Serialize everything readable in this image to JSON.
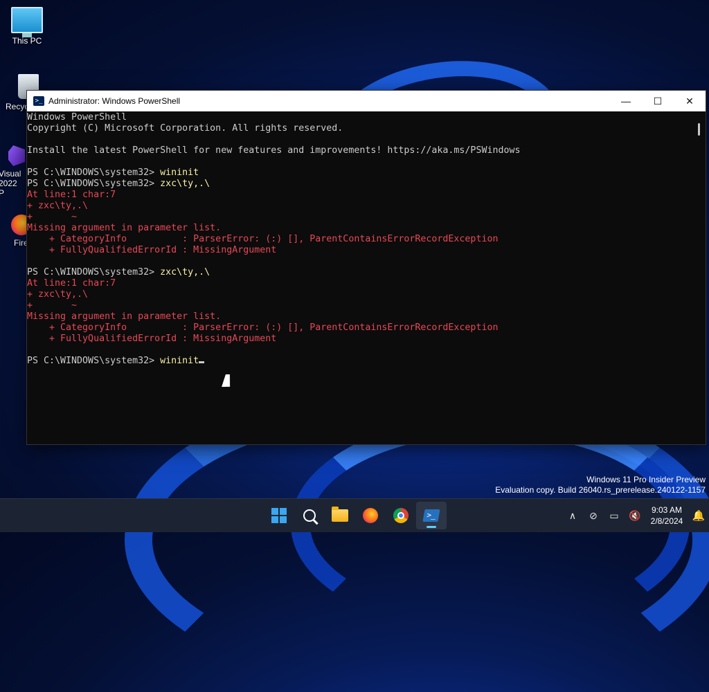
{
  "desktop": {
    "icons": [
      {
        "label": "This PC"
      },
      {
        "label": "Recyc"
      },
      {
        "label": "Visual 2022 P"
      },
      {
        "label": "Fire"
      }
    ]
  },
  "window": {
    "title": "Administrator: Windows PowerShell",
    "controls": {
      "minimize": "—",
      "maximize": "☐",
      "close": "✕"
    }
  },
  "console": {
    "lines": [
      {
        "text": "Windows PowerShell",
        "style": "normal"
      },
      {
        "text": "Copyright (C) Microsoft Corporation. All rights reserved.",
        "style": "normal"
      },
      {
        "text": "",
        "style": "normal"
      },
      {
        "text": "Install the latest PowerShell for new features and improvements! https://aka.ms/PSWindows",
        "style": "normal"
      },
      {
        "text": "",
        "style": "normal"
      },
      {
        "prompt": "PS C:\\WINDOWS\\system32> ",
        "command": "wininit",
        "style": "prompt"
      },
      {
        "prompt": "PS C:\\WINDOWS\\system32> ",
        "command": "zxc\\ty,.\\",
        "style": "prompt"
      },
      {
        "text": "At line:1 char:7",
        "style": "error"
      },
      {
        "text": "+ zxc\\ty,.\\",
        "style": "error"
      },
      {
        "text": "+       ~",
        "style": "error"
      },
      {
        "text": "Missing argument in parameter list.",
        "style": "error"
      },
      {
        "text": "    + CategoryInfo          : ParserError: (:) [], ParentContainsErrorRecordException",
        "style": "error"
      },
      {
        "text": "    + FullyQualifiedErrorId : MissingArgument",
        "style": "error"
      },
      {
        "text": "",
        "style": "normal"
      },
      {
        "prompt": "PS C:\\WINDOWS\\system32> ",
        "command": "zxc\\ty,.\\",
        "style": "prompt"
      },
      {
        "text": "At line:1 char:7",
        "style": "error"
      },
      {
        "text": "+ zxc\\ty,.\\",
        "style": "error"
      },
      {
        "text": "+       ~",
        "style": "error"
      },
      {
        "text": "Missing argument in parameter list.",
        "style": "error"
      },
      {
        "text": "    + CategoryInfo          : ParserError: (:) [], ParentContainsErrorRecordException",
        "style": "error"
      },
      {
        "text": "    + FullyQualifiedErrorId : MissingArgument",
        "style": "error"
      },
      {
        "text": "",
        "style": "normal"
      },
      {
        "prompt": "PS C:\\WINDOWS\\system32> ",
        "command": "wininit",
        "style": "current"
      }
    ]
  },
  "watermark": {
    "line1": "Windows 11 Pro Insider Preview",
    "line2": "Evaluation copy. Build 26040.rs_prerelease.240122-1157"
  },
  "taskbar": {
    "apps": [
      {
        "name": "start",
        "icon": "windows-logo-icon"
      },
      {
        "name": "search",
        "icon": "search-icon"
      },
      {
        "name": "file-explorer",
        "icon": "folder-icon"
      },
      {
        "name": "firefox",
        "icon": "firefox-icon"
      },
      {
        "name": "chrome",
        "icon": "chrome-icon"
      },
      {
        "name": "powershell",
        "icon": "powershell-icon",
        "active": true
      }
    ],
    "tray": {
      "chevron": "∧",
      "network": "⊘",
      "display": "▭",
      "volume": "🔇",
      "time": "9:03 AM",
      "date": "2/8/2024",
      "notification": "🔔"
    }
  },
  "colors": {
    "console_bg": "#0c0c0c",
    "console_text": "#cccccc",
    "error_text": "#e74856",
    "command_text": "#f9f1a5",
    "accent": "#60cdff"
  }
}
